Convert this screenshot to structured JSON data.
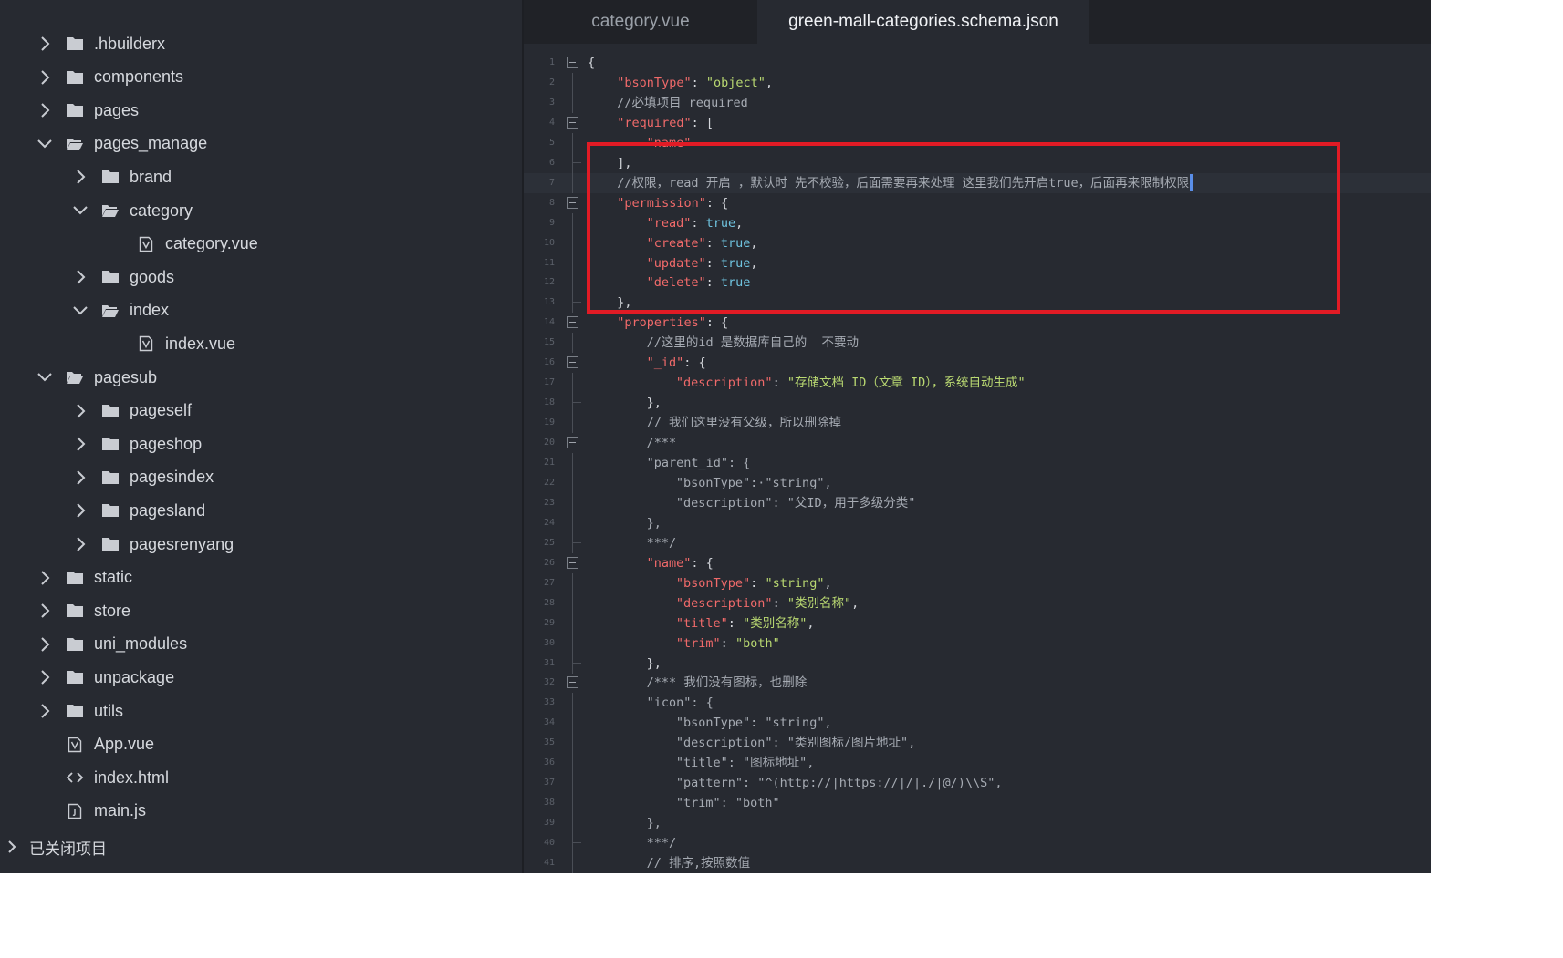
{
  "colors": {
    "background": "#272a31",
    "tabbar": "#202227",
    "key": "#f06a6a",
    "string": "#b9d871",
    "keyword": "#6fc3df",
    "comment": "#a6abb3",
    "highlight_box": "#e21b25",
    "cursor": "#5a8ee8"
  },
  "sidebar": {
    "items": [
      {
        "label": ".hbuilderx",
        "depth": 0,
        "kind": "folder",
        "state": "collapsed"
      },
      {
        "label": "components",
        "depth": 0,
        "kind": "folder",
        "state": "collapsed"
      },
      {
        "label": "pages",
        "depth": 0,
        "kind": "folder",
        "state": "collapsed"
      },
      {
        "label": "pages_manage",
        "depth": 0,
        "kind": "folder",
        "state": "expanded"
      },
      {
        "label": "brand",
        "depth": 1,
        "kind": "folder",
        "state": "collapsed"
      },
      {
        "label": "category",
        "depth": 1,
        "kind": "folder",
        "state": "expanded"
      },
      {
        "label": "category.vue",
        "depth": 2,
        "kind": "vue"
      },
      {
        "label": "goods",
        "depth": 1,
        "kind": "folder",
        "state": "collapsed"
      },
      {
        "label": "index",
        "depth": 1,
        "kind": "folder",
        "state": "expanded"
      },
      {
        "label": "index.vue",
        "depth": 2,
        "kind": "vue"
      },
      {
        "label": "pagesub",
        "depth": 0,
        "kind": "folder",
        "state": "expanded"
      },
      {
        "label": "pageself",
        "depth": 1,
        "kind": "folder",
        "state": "collapsed"
      },
      {
        "label": "pageshop",
        "depth": 1,
        "kind": "folder",
        "state": "collapsed"
      },
      {
        "label": "pagesindex",
        "depth": 1,
        "kind": "folder",
        "state": "collapsed"
      },
      {
        "label": "pagesland",
        "depth": 1,
        "kind": "folder",
        "state": "collapsed"
      },
      {
        "label": "pagesrenyang",
        "depth": 1,
        "kind": "folder",
        "state": "collapsed"
      },
      {
        "label": "static",
        "depth": 0,
        "kind": "folder",
        "state": "collapsed"
      },
      {
        "label": "store",
        "depth": 0,
        "kind": "folder",
        "state": "collapsed"
      },
      {
        "label": "uni_modules",
        "depth": 0,
        "kind": "folder",
        "state": "collapsed"
      },
      {
        "label": "unpackage",
        "depth": 0,
        "kind": "folder",
        "state": "collapsed"
      },
      {
        "label": "utils",
        "depth": 0,
        "kind": "folder",
        "state": "collapsed"
      },
      {
        "label": "App.vue",
        "depth": 0,
        "kind": "vue"
      },
      {
        "label": "index.html",
        "depth": 0,
        "kind": "html"
      },
      {
        "label": "main.js",
        "depth": 0,
        "kind": "js"
      }
    ],
    "closed_projects_label": "已关闭项目"
  },
  "editor": {
    "tabs": [
      {
        "label": "category.vue",
        "active": false
      },
      {
        "label": "green-mall-categories.schema.json",
        "active": true
      }
    ],
    "current_line": 7,
    "lines": [
      {
        "n": "1",
        "fold": "open",
        "indent": 0,
        "tokens": [
          [
            "p",
            "{"
          ]
        ]
      },
      {
        "n": "2",
        "indent": 1,
        "tokens": [
          [
            "k",
            "\"bsonType\""
          ],
          [
            "p",
            ": "
          ],
          [
            "s",
            "\"object\""
          ],
          [
            "p",
            ","
          ]
        ]
      },
      {
        "n": "3",
        "indent": 1,
        "tokens": [
          [
            "c",
            "//必填项目 required"
          ]
        ]
      },
      {
        "n": "4",
        "fold": "open",
        "indent": 1,
        "tokens": [
          [
            "k",
            "\"required\""
          ],
          [
            "p",
            ": ["
          ]
        ]
      },
      {
        "n": "5",
        "indent": 2,
        "tokens": [
          [
            "k",
            "\"name\""
          ]
        ]
      },
      {
        "n": "6",
        "fold": "end",
        "indent": 1,
        "tokens": [
          [
            "p",
            "],"
          ]
        ]
      },
      {
        "n": "7",
        "indent": 1,
        "cursor": true,
        "tokens": [
          [
            "c",
            "//权限，read 开启 ，默认时 先不校验，后面需要再来处理 这里我们先开启true，后面再来限制权限"
          ]
        ]
      },
      {
        "n": "8",
        "fold": "open",
        "indent": 1,
        "tokens": [
          [
            "k",
            "\"permission\""
          ],
          [
            "p",
            ": {"
          ]
        ]
      },
      {
        "n": "9",
        "indent": 2,
        "tokens": [
          [
            "k",
            "\"read\""
          ],
          [
            "p",
            ": "
          ],
          [
            "w",
            "true"
          ],
          [
            "p",
            ","
          ]
        ]
      },
      {
        "n": "10",
        "indent": 2,
        "tokens": [
          [
            "k",
            "\"create\""
          ],
          [
            "p",
            ": "
          ],
          [
            "w",
            "true"
          ],
          [
            "p",
            ","
          ]
        ]
      },
      {
        "n": "11",
        "indent": 2,
        "tokens": [
          [
            "k",
            "\"update\""
          ],
          [
            "p",
            ": "
          ],
          [
            "w",
            "true"
          ],
          [
            "p",
            ","
          ]
        ]
      },
      {
        "n": "12",
        "indent": 2,
        "tokens": [
          [
            "k",
            "\"delete\""
          ],
          [
            "p",
            ": "
          ],
          [
            "w",
            "true"
          ]
        ]
      },
      {
        "n": "13",
        "fold": "end",
        "indent": 1,
        "tokens": [
          [
            "p",
            "},"
          ]
        ]
      },
      {
        "n": "14",
        "fold": "open",
        "indent": 1,
        "tokens": [
          [
            "k",
            "\"properties\""
          ],
          [
            "p",
            ": {"
          ]
        ]
      },
      {
        "n": "15",
        "indent": 2,
        "tokens": [
          [
            "c",
            "//这里的id 是数据库自己的  不要动"
          ]
        ]
      },
      {
        "n": "16",
        "fold": "open",
        "indent": 2,
        "tokens": [
          [
            "k",
            "\"_id\""
          ],
          [
            "p",
            ": {"
          ]
        ]
      },
      {
        "n": "17",
        "indent": 3,
        "tokens": [
          [
            "k",
            "\"description\""
          ],
          [
            "p",
            ": "
          ],
          [
            "s",
            "\"存储文档 ID（文章 ID），系统自动生成\""
          ]
        ]
      },
      {
        "n": "18",
        "fold": "end",
        "indent": 2,
        "tokens": [
          [
            "p",
            "},"
          ]
        ]
      },
      {
        "n": "19",
        "indent": 2,
        "tokens": [
          [
            "c",
            "// 我们这里没有父级，所以删除掉"
          ]
        ]
      },
      {
        "n": "20",
        "fold": "open",
        "indent": 2,
        "tokens": [
          [
            "c",
            "/***"
          ]
        ]
      },
      {
        "n": "21",
        "indent": 2,
        "tokens": [
          [
            "c",
            "\"parent_id\": {"
          ]
        ]
      },
      {
        "n": "22",
        "indent": 3,
        "tokens": [
          [
            "c",
            "\"bsonType\":·\"string\","
          ]
        ]
      },
      {
        "n": "23",
        "indent": 3,
        "tokens": [
          [
            "c",
            "\"description\": \"父ID，用于多级分类\""
          ]
        ]
      },
      {
        "n": "24",
        "indent": 2,
        "tokens": [
          [
            "c",
            "},"
          ]
        ]
      },
      {
        "n": "25",
        "fold": "end",
        "indent": 2,
        "tokens": [
          [
            "c",
            "***/"
          ]
        ]
      },
      {
        "n": "26",
        "fold": "open",
        "indent": 2,
        "tokens": [
          [
            "k",
            "\"name\""
          ],
          [
            "p",
            ": {"
          ]
        ]
      },
      {
        "n": "27",
        "indent": 3,
        "tokens": [
          [
            "k",
            "\"bsonType\""
          ],
          [
            "p",
            ": "
          ],
          [
            "s",
            "\"string\""
          ],
          [
            "p",
            ","
          ]
        ]
      },
      {
        "n": "28",
        "indent": 3,
        "tokens": [
          [
            "k",
            "\"description\""
          ],
          [
            "p",
            ": "
          ],
          [
            "s",
            "\"类别名称\""
          ],
          [
            "p",
            ","
          ]
        ]
      },
      {
        "n": "29",
        "indent": 3,
        "tokens": [
          [
            "k",
            "\"title\""
          ],
          [
            "p",
            ": "
          ],
          [
            "s",
            "\"类别名称\""
          ],
          [
            "p",
            ","
          ]
        ]
      },
      {
        "n": "30",
        "indent": 3,
        "tokens": [
          [
            "k",
            "\"trim\""
          ],
          [
            "p",
            ": "
          ],
          [
            "s",
            "\"both\""
          ]
        ]
      },
      {
        "n": "31",
        "fold": "end",
        "indent": 2,
        "tokens": [
          [
            "p",
            "},"
          ]
        ]
      },
      {
        "n": "32",
        "fold": "open",
        "indent": 2,
        "tokens": [
          [
            "c",
            "/*** 我们没有图标，也删除"
          ]
        ]
      },
      {
        "n": "33",
        "indent": 2,
        "tokens": [
          [
            "c",
            "\"icon\": {"
          ]
        ]
      },
      {
        "n": "34",
        "indent": 3,
        "tokens": [
          [
            "c",
            "\"bsonType\": \"string\","
          ]
        ]
      },
      {
        "n": "35",
        "indent": 3,
        "tokens": [
          [
            "c",
            "\"description\": \"类别图标/图片地址\","
          ]
        ]
      },
      {
        "n": "36",
        "indent": 3,
        "tokens": [
          [
            "c",
            "\"title\": \"图标地址\","
          ]
        ]
      },
      {
        "n": "37",
        "indent": 3,
        "tokens": [
          [
            "c",
            "\"pattern\": \"^(http://|https://|/|./|@/)\\\\S\","
          ]
        ]
      },
      {
        "n": "38",
        "indent": 3,
        "tokens": [
          [
            "c",
            "\"trim\": \"both\""
          ]
        ]
      },
      {
        "n": "39",
        "indent": 2,
        "tokens": [
          [
            "c",
            "},"
          ]
        ]
      },
      {
        "n": "40",
        "fold": "end",
        "indent": 2,
        "tokens": [
          [
            "c",
            "***/"
          ]
        ]
      },
      {
        "n": "41",
        "indent": 2,
        "tokens": [
          [
            "c",
            "// 排序,按照数值"
          ]
        ]
      }
    ]
  }
}
